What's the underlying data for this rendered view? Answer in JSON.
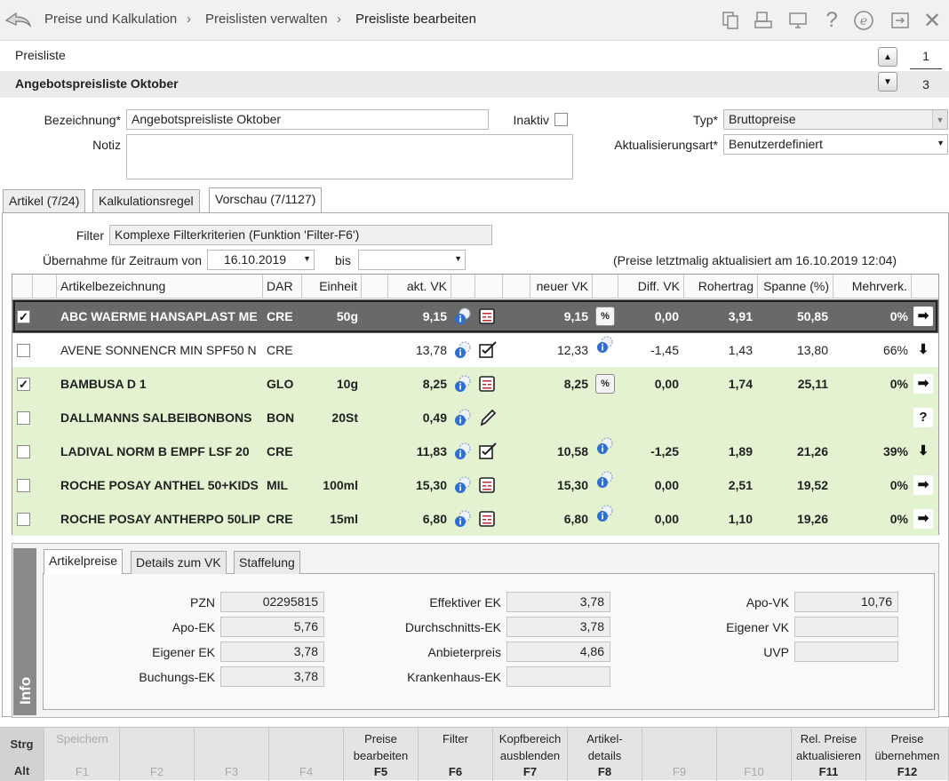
{
  "breadcrumb": [
    "Preise und Kalkulation",
    "Preislisten verwalten",
    "Preisliste bearbeiten"
  ],
  "toolbar_icons": [
    "document-copy-icon",
    "print-icon",
    "monitor-icon",
    "help-icon",
    "e-icon",
    "export-icon",
    "close-icon"
  ],
  "header": {
    "label": "Preisliste",
    "name": "Angebotspreisliste Oktober",
    "page_current": "1",
    "page_total": "3"
  },
  "form": {
    "bezeichnung_label": "Bezeichnung*",
    "bezeichnung_value": "Angebotspreisliste Oktober",
    "notiz_label": "Notiz",
    "notiz_value": "",
    "inaktiv_label": "Inaktiv",
    "typ_label": "Typ*",
    "typ_value": "Bruttopreise",
    "aktualisierung_label": "Aktualisierungsart*",
    "aktualisierung_value": "Benutzerdefiniert"
  },
  "tabs": [
    {
      "label": "Artikel (7/24)",
      "active": false
    },
    {
      "label": "Kalkulationsregel",
      "active": false
    },
    {
      "label": "Vorschau (7/1127)",
      "active": true
    }
  ],
  "filter": {
    "label": "Filter",
    "value": "Komplexe Filterkriterien (Funktion 'Filter-F6')",
    "zeitraum_label": "Übernahme für Zeitraum von",
    "date_from": "16.10.2019",
    "bis_label": "bis",
    "date_to": "",
    "update_note": "(Preise letztmalig aktualisiert am 16.10.2019 12:04)"
  },
  "table": {
    "columns": [
      "Artikelbezeichnung",
      "DAR",
      "Einheit",
      "akt. VK",
      "neuer VK",
      "Diff. VK",
      "Rohertrag",
      "Spanne (%)",
      "Mehrverk."
    ],
    "rows": [
      {
        "checked": true,
        "name": "ABC WAERME HANSAPLAST ME",
        "dar": "CRE",
        "einheit": "50g",
        "akt_vk": "9,15",
        "calc_icon": "calculator-icon",
        "neuer_vk": "9,15",
        "neu_icon": "percent-icon",
        "diff": "0,00",
        "rohertrag": "3,91",
        "spanne": "50,85",
        "mehr": "0%",
        "trend": "arrow-right-percent-icon",
        "bold": true,
        "style": "selected"
      },
      {
        "checked": false,
        "name": "AVENE SONNENCR MIN SPF50 N",
        "dar": "CRE",
        "einheit": "",
        "akt_vk": "13,78",
        "calc_icon": "edit-note-icon",
        "neuer_vk": "12,33",
        "neu_icon": "info-gear-icon",
        "diff": "-1,45",
        "rohertrag": "1,43",
        "spanne": "13,80",
        "mehr": "66%",
        "trend": "arrow-down-icon",
        "bold": false,
        "style": "white"
      },
      {
        "checked": true,
        "name": "BAMBUSA D 1",
        "dar": "GLO",
        "einheit": "10g",
        "akt_vk": "8,25",
        "calc_icon": "calculator-icon",
        "neuer_vk": "8,25",
        "neu_icon": "percent-icon",
        "diff": "0,00",
        "rohertrag": "1,74",
        "spanne": "25,11",
        "mehr": "0%",
        "trend": "arrow-right-percent-icon",
        "bold": true,
        "style": "green"
      },
      {
        "checked": false,
        "name": "DALLMANNS SALBEIBONBONS",
        "dar": "BON",
        "einheit": "20St",
        "akt_vk": "0,49",
        "calc_icon": "pencil-icon",
        "neuer_vk": "",
        "neu_icon": "",
        "diff": "",
        "rohertrag": "",
        "spanne": "",
        "mehr": "",
        "trend": "question-icon",
        "bold": true,
        "style": "green"
      },
      {
        "checked": false,
        "name": "LADIVAL NORM B EMPF LSF 20",
        "dar": "CRE",
        "einheit": "",
        "akt_vk": "11,83",
        "calc_icon": "edit-note-icon",
        "neuer_vk": "10,58",
        "neu_icon": "info-gear-icon",
        "diff": "-1,25",
        "rohertrag": "1,89",
        "spanne": "21,26",
        "mehr": "39%",
        "trend": "arrow-down-icon",
        "bold": true,
        "style": "green"
      },
      {
        "checked": false,
        "name": "ROCHE POSAY ANTHEL 50+KIDS",
        "dar": "MIL",
        "einheit": "100ml",
        "akt_vk": "15,30",
        "calc_icon": "calculator-icon",
        "neuer_vk": "15,30",
        "neu_icon": "info-gear-icon",
        "diff": "0,00",
        "rohertrag": "2,51",
        "spanne": "19,52",
        "mehr": "0%",
        "trend": "arrow-right-icon",
        "bold": true,
        "style": "green"
      },
      {
        "checked": false,
        "name": "ROCHE POSAY ANTHERPO 50LIP",
        "dar": "CRE",
        "einheit": "15ml",
        "akt_vk": "6,80",
        "calc_icon": "calculator-icon",
        "neuer_vk": "6,80",
        "neu_icon": "info-gear-icon",
        "diff": "0,00",
        "rohertrag": "1,10",
        "spanne": "19,26",
        "mehr": "0%",
        "trend": "arrow-right-icon",
        "bold": true,
        "style": "green"
      }
    ]
  },
  "info": {
    "side_label": "Info",
    "tabs": [
      "Artikelpreise",
      "Details zum VK",
      "Staffelung"
    ],
    "col1": [
      {
        "label": "PZN",
        "value": "02295815"
      },
      {
        "label": "Apo-EK",
        "value": "5,76"
      },
      {
        "label": "Eigener EK",
        "value": "3,78"
      },
      {
        "label": "Buchungs-EK",
        "value": "3,78"
      }
    ],
    "col2": [
      {
        "label": "Effektiver EK",
        "value": "3,78"
      },
      {
        "label": "Durchschnitts-EK",
        "value": "3,78"
      },
      {
        "label": "Anbieterpreis",
        "value": "4,86"
      },
      {
        "label": "Krankenhaus-EK",
        "value": ""
      }
    ],
    "col3": [
      {
        "label": "Apo-VK",
        "value": "10,76"
      },
      {
        "label": "Eigener VK",
        "value": ""
      },
      {
        "label": "UVP",
        "value": ""
      }
    ]
  },
  "fkeys": {
    "strg": "Strg",
    "alt": "Alt",
    "keys": [
      {
        "label": "Speichern",
        "key": "F1",
        "enabled": false
      },
      {
        "label": "",
        "key": "F2",
        "enabled": false
      },
      {
        "label": "",
        "key": "F3",
        "enabled": false
      },
      {
        "label": "",
        "key": "F4",
        "enabled": false
      },
      {
        "label": "Preise bearbeiten",
        "key": "F5",
        "enabled": true
      },
      {
        "label": "Filter",
        "key": "F6",
        "enabled": true
      },
      {
        "label": "Kopfbereich ausblenden",
        "key": "F7",
        "enabled": true
      },
      {
        "label": "Artikel-details",
        "key": "F8",
        "enabled": true
      },
      {
        "label": "",
        "key": "F9",
        "enabled": false
      },
      {
        "label": "",
        "key": "F10",
        "enabled": false
      },
      {
        "label": "Rel. Preise aktualisieren",
        "key": "F11",
        "enabled": true
      },
      {
        "label": "Preise übernehmen",
        "key": "F12",
        "enabled": true
      }
    ]
  },
  "colors": {
    "row_selected": "#696969",
    "row_green": "#e3f2d1",
    "info_sidebar": "#8a8a8a"
  }
}
